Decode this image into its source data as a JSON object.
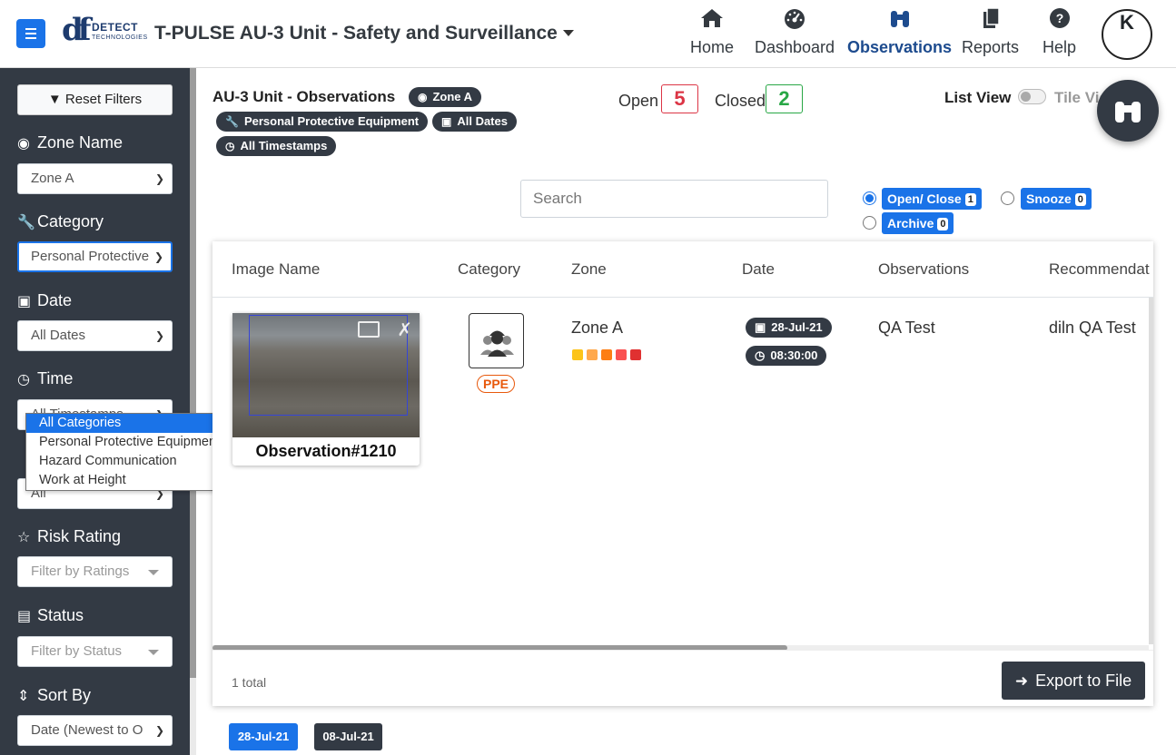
{
  "header": {
    "logo_name": "DETECT",
    "logo_sub": "TECHNOLOGIES",
    "app_title": "T-PULSE  AU-3 Unit - Safety and Surveillance",
    "nav": [
      {
        "label": "Home",
        "icon": "home-icon"
      },
      {
        "label": "Dashboard",
        "icon": "dashboard-icon"
      },
      {
        "label": "Observations",
        "icon": "binoculars-icon",
        "active": true
      },
      {
        "label": "Reports",
        "icon": "reports-icon"
      },
      {
        "label": "Help",
        "icon": "help-icon"
      }
    ],
    "avatar_initial": "K"
  },
  "sidebar": {
    "reset_label": "Reset Filters",
    "zone_label": "Zone Name",
    "zone_value": "Zone A",
    "category_label": "Category",
    "category_value": "Personal Protective",
    "date_label": "Date",
    "date_value": "All Dates",
    "time_label": "Time",
    "time_value": "All Timestamps",
    "hidden_value": "All",
    "risk_label": "Risk Rating",
    "risk_placeholder": "Filter by Ratings",
    "status_label": "Status",
    "status_placeholder": "Filter by Status",
    "sort_label": "Sort By",
    "sort_value": "Date (Newest to O"
  },
  "category_dropdown": {
    "options": [
      "All Categories",
      "Personal Protective Equipment",
      "Hazard Communication",
      "Work at Height"
    ],
    "highlighted_index": 0
  },
  "main": {
    "heading": "AU-3 Unit - Observations",
    "chips": {
      "zone": "Zone A",
      "category": "Personal Protective Equipment",
      "dates": "All Dates",
      "timestamps": "All Timestamps"
    },
    "open_label": "Open",
    "open_count": "5",
    "closed_label": "Closed",
    "closed_count": "2",
    "list_view_label": "List View",
    "tile_view_label": "Tile View",
    "search_placeholder": "Search",
    "status_filters": [
      {
        "label": "Open/ Close",
        "count": "1",
        "selected": true
      },
      {
        "label": "Snooze",
        "count": "0",
        "selected": false
      },
      {
        "label": "Archive",
        "count": "0",
        "selected": false
      }
    ]
  },
  "table": {
    "columns": [
      "Image Name",
      "Category",
      "Zone",
      "Date",
      "Observations",
      "Recommendat"
    ],
    "rows": [
      {
        "image_title": "Observation#1210",
        "category_badge": "PPE",
        "zone": "Zone A",
        "risk_colors": [
          "#fcc419",
          "#ffa94d",
          "#fd7e14",
          "#fa5252",
          "#e03131"
        ],
        "date": "28-Jul-21",
        "time": "08:30:00",
        "observation": "QA Test",
        "recommendation": "diln QA Test"
      }
    ],
    "total_text": "1 total",
    "export_label": "Export to File"
  },
  "date_chips": [
    {
      "label": "28-Jul-21",
      "color": "#1a73e8"
    },
    {
      "label": "08-Jul-21",
      "color": "#333a44"
    }
  ],
  "colors": {
    "primary": "#1a73e8",
    "sidebar_bg": "#333a44",
    "open_red": "#dc3545",
    "closed_green": "#28a745",
    "ppe_orange": "#e8590c"
  }
}
